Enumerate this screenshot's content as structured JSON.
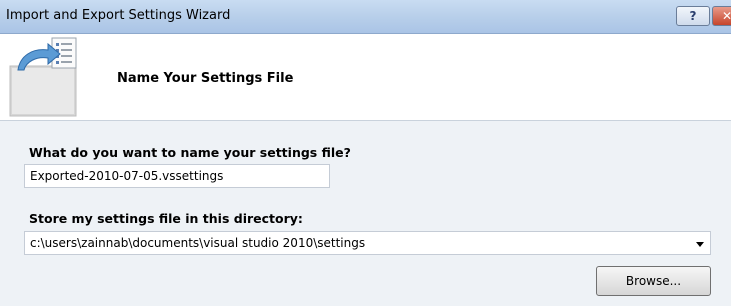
{
  "window": {
    "title": "Import and Export Settings Wizard",
    "help_label": "?",
    "close_label": "✕"
  },
  "header": {
    "title": "Name Your Settings File",
    "icon": "settings-export-icon"
  },
  "form": {
    "name_label": "What do you want to name your settings file?",
    "name_value": "Exported-2010-07-05.vssettings",
    "dir_label": "Store my settings file in this directory:",
    "dir_value": "c:\\users\\zainnab\\documents\\visual studio 2010\\settings",
    "browse_label": "Browse..."
  },
  "colors": {
    "titlebar": "#b8cfea",
    "content_bg": "#eef2f6",
    "close_button": "#c6452c"
  }
}
